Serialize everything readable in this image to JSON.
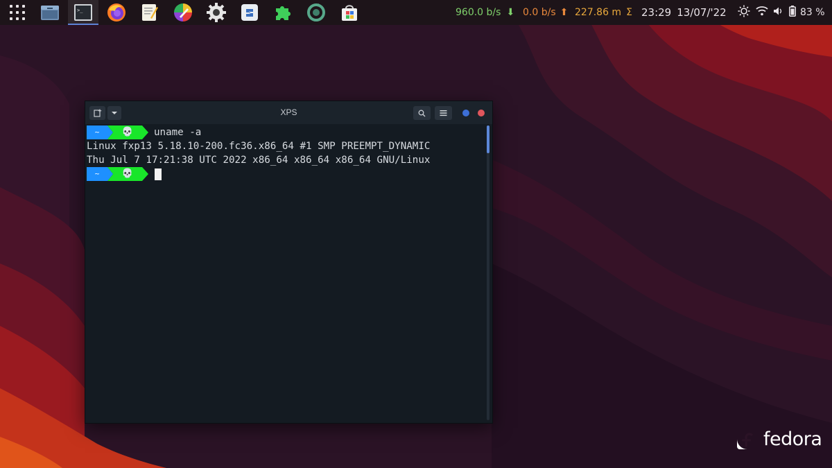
{
  "colors": {
    "panel_bg": "#1d1419",
    "terminal_bg": "#141b22",
    "titlebar_bg": "#1b232b",
    "prompt_home": "#1e90ff",
    "prompt_skull": "#19e62a",
    "net_down": "#7fd06b",
    "net_up": "#e8883c",
    "accent_blue": "#3d6fd6",
    "close_red": "#e0565c"
  },
  "dock": {
    "apps": [
      {
        "name": "app-grid-icon"
      },
      {
        "name": "files-icon"
      },
      {
        "name": "terminal-icon",
        "active": true
      },
      {
        "name": "firefox-icon"
      },
      {
        "name": "text-editor-icon"
      },
      {
        "name": "color-picker-icon"
      },
      {
        "name": "settings-icon"
      },
      {
        "name": "software-icon"
      },
      {
        "name": "extensions-icon"
      },
      {
        "name": "timeshift-icon"
      },
      {
        "name": "app-store-icon"
      }
    ]
  },
  "tray": {
    "net_down": "960.0 b/s",
    "net_down_arrow": "⬇",
    "net_up": "0.0 b/s",
    "net_up_arrow": "⬆",
    "cpu_load": "227.86 m",
    "sigma": "Σ",
    "time": "23:29",
    "date": "13/07/'22",
    "battery": "83 %",
    "icons": [
      "brightness-icon",
      "wifi-icon",
      "volume-icon",
      "battery-icon"
    ]
  },
  "terminal": {
    "title": "XPS",
    "prompt_home": "~",
    "prompt_skull": "💀",
    "command": "uname -a",
    "output": [
      "Linux fxp13 5.18.10-200.fc36.x86_64 #1 SMP PREEMPT_DYNAMIC",
      "Thu Jul 7 17:21:38 UTC 2022 x86_64 x86_64 x86_64 GNU/Linux"
    ]
  },
  "branding": {
    "wordmark": "fedora"
  }
}
